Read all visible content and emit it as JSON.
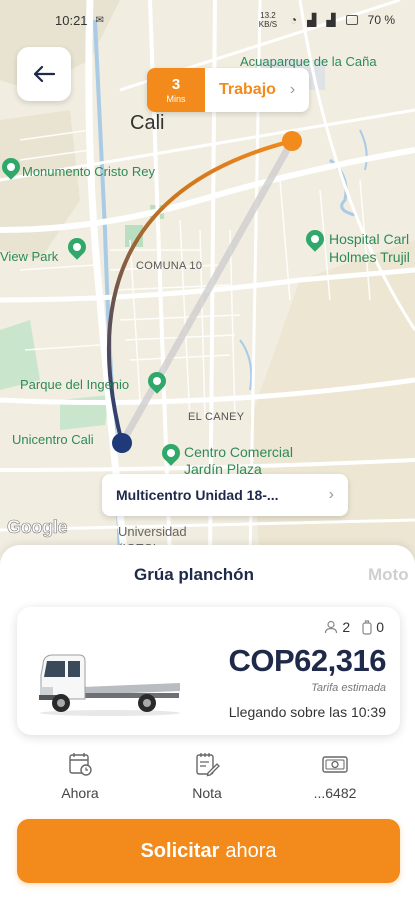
{
  "status_bar": {
    "time": "10:21",
    "data_rate": "13.2 KB/S",
    "battery": "70 %"
  },
  "map": {
    "labels": {
      "acuaparque": "Acuaparque de la Caña",
      "cali": "Cali",
      "monumento": "Monumento Cristo Rey",
      "view_park": "View Park",
      "comuna": "COMUNA 10",
      "hospital_1": "Hospital Carl",
      "hospital_2": "Holmes Trujil",
      "parque_ingenio": "Parque del Ingenio",
      "el_caney": "EL CANEY",
      "unicentro": "Unicentro Cali",
      "centro_comercial_1": "Centro Comercial",
      "centro_comercial_2": "Jardín Plaza",
      "universidad_1": "Universidad",
      "universidad_2": "(ICESI"
    },
    "google_logo": "Google",
    "route_color_start": "#1f3a78",
    "route_color_end": "#f28a1c"
  },
  "destination": {
    "eta_value": "3",
    "eta_unit": "Mins",
    "name": "Trabajo"
  },
  "origin": {
    "name": "Multicentro Unidad 18-..."
  },
  "service_tabs": [
    {
      "label": "Grúa planchón",
      "selected": true
    },
    {
      "label": "Moto",
      "selected": false
    }
  ],
  "card": {
    "passengers": "2",
    "luggage": "0",
    "price": "COP62,316",
    "price_note": "Tarifa estimada",
    "arrival": "Llegando sobre las 10:39"
  },
  "options": [
    {
      "label": "Ahora",
      "icon": "calendar-clock-icon"
    },
    {
      "label": "Nota",
      "icon": "note-edit-icon"
    },
    {
      "label": "...6482",
      "icon": "cash-icon"
    }
  ],
  "cta": {
    "bold": "Solicitar",
    "rest": "ahora"
  },
  "colors": {
    "accent": "#f28a1c",
    "navy": "#1f2a4a"
  }
}
